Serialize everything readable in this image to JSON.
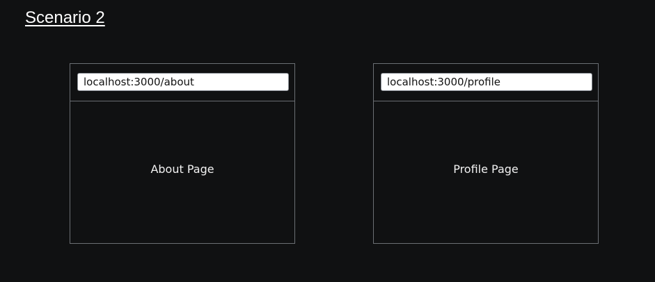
{
  "title": "Scenario 2",
  "windows": [
    {
      "url": "localhost:3000/about",
      "page_label": "About Page"
    },
    {
      "url": "localhost:3000/profile",
      "page_label": "Profile Page"
    }
  ],
  "colors": {
    "background": "#101112",
    "border": "#6b6f74",
    "text": "#ffffff",
    "address_bar_bg": "#ffffff"
  }
}
